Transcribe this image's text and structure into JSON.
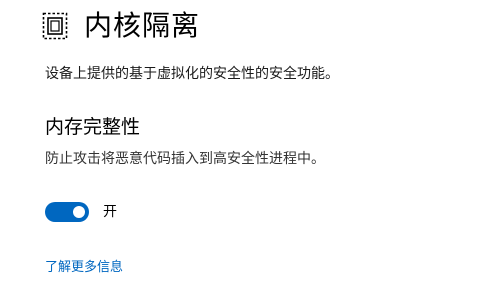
{
  "header": {
    "icon": "core-isolation-icon",
    "title": "内核隔离"
  },
  "description": "设备上提供的基于虚拟化的安全性的安全功能。",
  "memory_integrity": {
    "title": "内存完整性",
    "description": "防止攻击将恶意代码插入到高安全性进程中。",
    "toggle_state": true,
    "toggle_label": "开",
    "accent_color": "#0067c0"
  },
  "learn_more_label": "了解更多信息"
}
